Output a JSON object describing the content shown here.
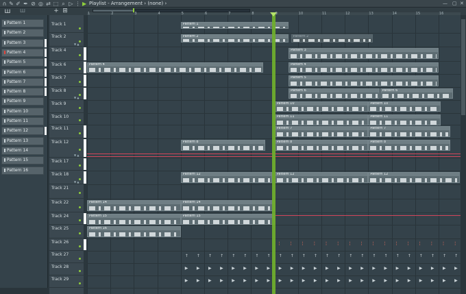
{
  "window": {
    "title": "Playlist - Arrangement",
    "pattern_selector": "(none)",
    "arrow_glyph": "▶"
  },
  "colors": {
    "playhead": "#6fae2d",
    "accent_green": "#8fcf3c",
    "red_marker": "#d2455a",
    "clip": "#5d6c72"
  },
  "toolbar": {
    "icons": [
      "magnet-icon",
      "pencil-icon",
      "paint-icon",
      "delete-icon",
      "mute-icon",
      "slip-icon",
      "select-icon",
      "zoom-icon",
      "play-icon"
    ]
  },
  "picker": {
    "items": [
      "Pattern 1",
      "Pattern 2",
      "Pattern 3",
      "Pattern 4",
      "Pattern 5",
      "Pattern 6",
      "Pattern 7",
      "Pattern 8",
      "Pattern 9",
      "Pattern 10",
      "Pattern 11",
      "Pattern 12",
      "Pattern 13",
      "Pattern 14",
      "Pattern 15",
      "Pattern 16"
    ],
    "selected": "Pattern 4"
  },
  "ruler": {
    "bars": [
      "1",
      "2",
      "3",
      "4",
      "5",
      "6",
      "7",
      "8",
      "9",
      "10",
      "11",
      "12",
      "13",
      "14",
      "15",
      "16"
    ]
  },
  "tracks": [
    {
      "name": "Track 1"
    },
    {
      "name": "Track 2"
    },
    {
      "name": "Track 4"
    },
    {
      "name": "Track 6"
    },
    {
      "name": "Track 7"
    },
    {
      "name": "Track 8"
    },
    {
      "name": "Track 9"
    },
    {
      "name": "Track 10"
    },
    {
      "name": "Track 11"
    },
    {
      "name": "Track 12"
    },
    {
      "name": "Track 17"
    },
    {
      "name": "Track 18"
    },
    {
      "name": "Track 21"
    },
    {
      "name": "Track 22"
    },
    {
      "name": "Track 24"
    },
    {
      "name": "Track 25"
    },
    {
      "name": "Track 26"
    },
    {
      "name": "Track 27"
    },
    {
      "name": "Track 28"
    },
    {
      "name": "Track 29"
    }
  ],
  "clips": [
    {
      "label": "Pattern 1"
    },
    {
      "label": "Pattern 2"
    },
    {
      "label": "Pattern 2"
    },
    {
      "label": "Pattern 3"
    },
    {
      "label": "Pattern 4"
    },
    {
      "label": "Pattern 4"
    },
    {
      "label": "Pattern 5"
    },
    {
      "label": "Pattern 6"
    },
    {
      "label": "Pattern 6"
    },
    {
      "label": "Pattern 10"
    },
    {
      "label": "Pattern 10"
    },
    {
      "label": "Pattern 11"
    },
    {
      "label": "Pattern 11"
    },
    {
      "label": "Pattern 7"
    },
    {
      "label": "Pattern 7"
    },
    {
      "label": "Pattern 8"
    },
    {
      "label": "Pattern 8"
    },
    {
      "label": "Pattern 8"
    },
    {
      "label": "Pattern 12"
    },
    {
      "label": "Pattern 12"
    },
    {
      "label": "Pattern 12"
    },
    {
      "label": "Pattern 14"
    },
    {
      "label": "Pattern 14"
    },
    {
      "label": "Pattern 15"
    },
    {
      "label": "Pattern 15"
    },
    {
      "label": "Pattern 16"
    }
  ]
}
